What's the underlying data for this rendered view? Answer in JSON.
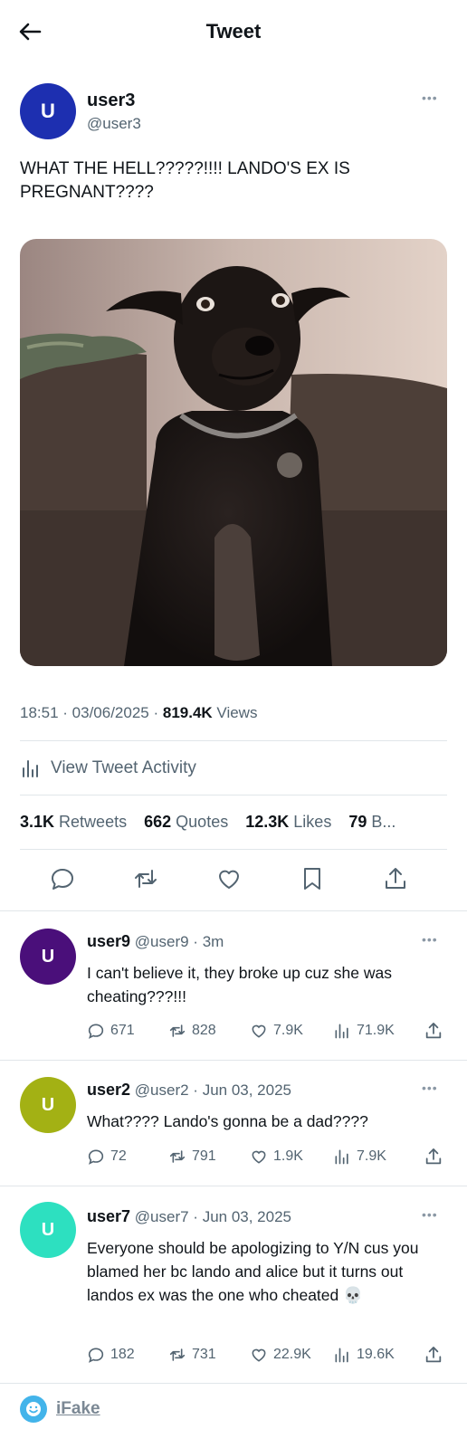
{
  "header": {
    "title": "Tweet"
  },
  "tweet": {
    "avatar_letter": "U",
    "avatar_color": "#1d2fb0",
    "name": "user3",
    "handle": "@user3",
    "text": "WHAT THE HELL?????!!!! LANDO'S EX IS PREGNANT????",
    "image_subject": "dog-photo",
    "time": "18:51",
    "date": "03/06/2025",
    "views_count": "819.4K",
    "views_label": "Views",
    "activity_label": "View Tweet Activity",
    "stats": {
      "retweets_count": "3.1K",
      "retweets_label": "Retweets",
      "quotes_count": "662",
      "quotes_label": "Quotes",
      "likes_count": "12.3K",
      "likes_label": "Likes",
      "bookmarks_count": "79",
      "bookmarks_label": "B..."
    }
  },
  "replies": [
    {
      "avatar_letter": "U",
      "avatar_color": "#4a0f7a",
      "name": "user9",
      "handle": "@user9",
      "time": "3m",
      "text": "I can't believe it, they broke up cuz she was cheating???!!!",
      "replies": "671",
      "retweets": "828",
      "likes": "7.9K",
      "views": "71.9K"
    },
    {
      "avatar_letter": "U",
      "avatar_color": "#a3b114",
      "name": "user2",
      "handle": "@user2",
      "time": "Jun 03, 2025",
      "text": "What???? Lando's gonna be a dad????",
      "replies": "72",
      "retweets": "791",
      "likes": "1.9K",
      "views": "7.9K"
    },
    {
      "avatar_letter": "U",
      "avatar_color": "#2de0c0",
      "name": "user7",
      "handle": "@user7",
      "time": "Jun 03, 2025",
      "text": "Everyone should be apologizing to Y/N cus you blamed her bc lando and alice but it turns out landos ex was the one who cheated 💀",
      "replies": "182",
      "retweets": "731",
      "likes": "22.9K",
      "views": "19.6K"
    }
  ],
  "footer": {
    "brand": "iFake"
  },
  "colors": {
    "text": "#0f1419",
    "muted": "#536471",
    "divider": "#e1e6ea",
    "footer_logo": "#43b4ea"
  }
}
